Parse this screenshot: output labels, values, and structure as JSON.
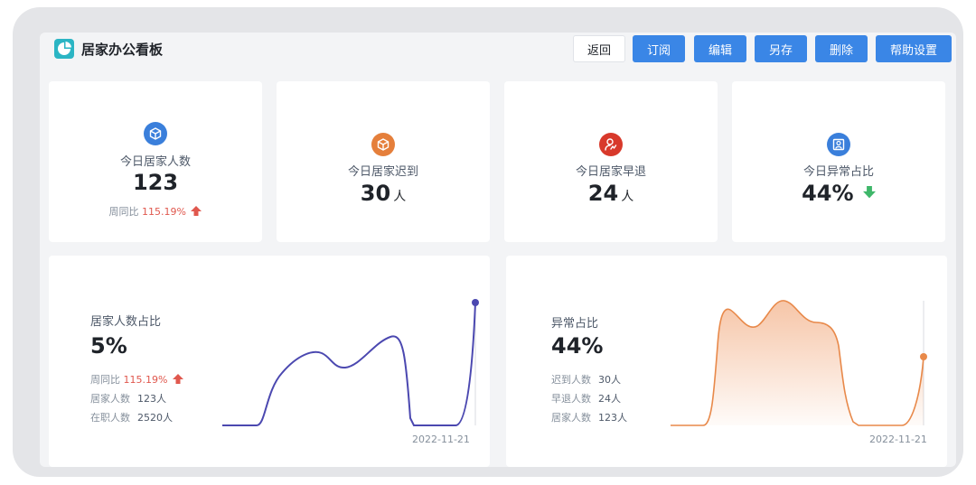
{
  "header": {
    "title": "居家办公看板",
    "buttons": {
      "back": "返回",
      "subscribe": "订阅",
      "edit": "编辑",
      "save_as": "另存",
      "delete": "删除",
      "help_settings": "帮助设置"
    }
  },
  "stats": [
    {
      "label": "今日居家人数",
      "value": "123",
      "unit": "",
      "compare_label": "周同比",
      "compare_value": "115.19%",
      "icon": "box-icon",
      "icon_color": "#3a7fdb"
    },
    {
      "label": "今日居家迟到",
      "value": "30",
      "unit": "人",
      "icon": "box-icon",
      "icon_color": "#e57f3b"
    },
    {
      "label": "今日居家早退",
      "value": "24",
      "unit": "人",
      "icon": "person-sign-icon",
      "icon_color": "#d8392b"
    },
    {
      "label": "今日异常占比",
      "value": "44%",
      "unit": "",
      "icon": "portrait-icon",
      "icon_color": "#3a7fdb",
      "trend": "down"
    }
  ],
  "charts": {
    "left": {
      "title": "居家人数占比",
      "value": "5%",
      "compare_label": "周同比",
      "compare_value": "115.19%",
      "rows": [
        {
          "label": "居家人数",
          "value": "123人"
        },
        {
          "label": "在职人数",
          "value": "2520人"
        }
      ],
      "date": "2022-11-21",
      "color": "#4b48b0"
    },
    "right": {
      "title": "异常占比",
      "value": "44%",
      "rows": [
        {
          "label": "迟到人数",
          "value": "30人"
        },
        {
          "label": "早退人数",
          "value": "24人"
        },
        {
          "label": "居家人数",
          "value": "123人"
        }
      ],
      "date": "2022-11-21",
      "color": "#e8894a"
    }
  },
  "colors": {
    "primary": "#3a86e6",
    "up": "#e0584e",
    "down": "#3fb76a"
  }
}
